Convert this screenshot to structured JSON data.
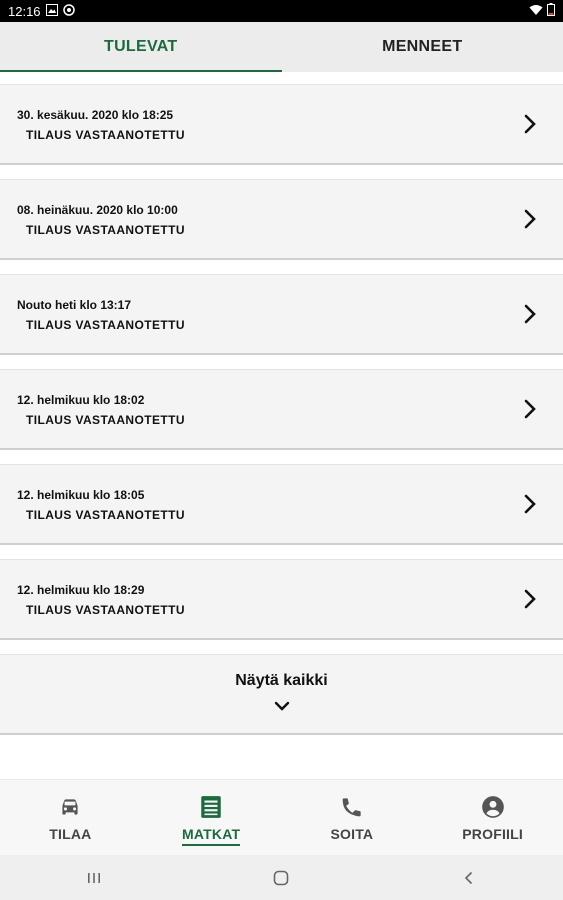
{
  "status_bar": {
    "time": "12:16",
    "icons": [
      "image-icon",
      "sync-icon",
      "wifi-icon",
      "battery-icon"
    ]
  },
  "tabs": [
    {
      "label": "TULEVAT",
      "active": true
    },
    {
      "label": "MENNEET",
      "active": false
    }
  ],
  "trips": [
    {
      "date": "30. kesäkuu. 2020 klo 18:25",
      "status": "TILAUS VASTAANOTETTU"
    },
    {
      "date": "08. heinäkuu. 2020 klo 10:00",
      "status": "TILAUS VASTAANOTETTU"
    },
    {
      "date": "Nouto heti klo 13:17",
      "status": "TILAUS VASTAANOTETTU"
    },
    {
      "date": "12. helmikuu klo 18:02",
      "status": "TILAUS VASTAANOTETTU"
    },
    {
      "date": "12. helmikuu klo 18:05",
      "status": "TILAUS VASTAANOTETTU"
    },
    {
      "date": "12. helmikuu klo 18:29",
      "status": "TILAUS VASTAANOTETTU"
    }
  ],
  "show_all": {
    "label": "Näytä kaikki"
  },
  "bottom_nav": [
    {
      "label": "TILAA",
      "icon": "car-icon",
      "active": false
    },
    {
      "label": "MATKAT",
      "icon": "list-icon",
      "active": true
    },
    {
      "label": "SOITA",
      "icon": "phone-icon",
      "active": false
    },
    {
      "label": "PROFIILI",
      "icon": "account-icon",
      "active": false
    }
  ],
  "colors": {
    "accent": "#1b6b3c",
    "card_bg": "#f4f4f4",
    "tab_bg": "#ececec"
  }
}
